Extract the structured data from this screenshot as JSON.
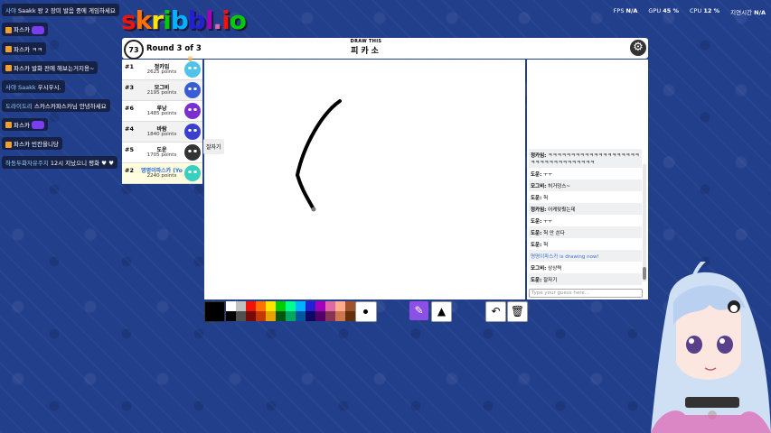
{
  "stream_chat": [
    {
      "nick": "사야",
      "text": "Saakk 왕 2 장미 발음 중에 게임하세요",
      "emote": false
    },
    {
      "nick": "",
      "text": "파스카",
      "emote": true,
      "badge": true
    },
    {
      "nick": "",
      "text": "파스카 ㅋㅋ",
      "emote": false,
      "badge": true
    },
    {
      "nick": "",
      "text": "파스카 발화 전에 해보는거지용~",
      "emote": false,
      "badge": true
    },
    {
      "nick": "사야 Saakk",
      "text": "우시우시.",
      "emote": false
    },
    {
      "nick": "도라이도리",
      "text": "스카스카파스카님 안녕하세요",
      "emote": false
    },
    {
      "nick": "",
      "text": "파스카",
      "emote": true,
      "badge": true
    },
    {
      "nick": "",
      "text": "파스카 빈칸을니당",
      "emote": false,
      "badge": true
    },
    {
      "nick": "하동두화자유주지",
      "text": "12시 지났으니 평화 ♥ ♥",
      "emote": false
    }
  ],
  "perf": {
    "fps_label": "FPS",
    "fps": "N/A",
    "gpu_label": "GPU",
    "gpu": "45 %",
    "cpu_label": "CPU",
    "cpu": "12 %",
    "latency_label": "지연시간",
    "latency": "N/A"
  },
  "logo": {
    "text": "skribbl.io"
  },
  "game": {
    "timer": "73",
    "round": "Round 3 of 3",
    "word_hint": "DRAW THIS",
    "word": "피카소"
  },
  "players": [
    {
      "rank": "#1",
      "name": "정카임",
      "points": "2625 points",
      "color": "#4fc3e8",
      "crown": true
    },
    {
      "rank": "#3",
      "name": "모그비",
      "points": "2195 points",
      "color": "#3a5bd6"
    },
    {
      "rank": "#6",
      "name": "루낭",
      "points": "1485 points",
      "color": "#7c2fd0"
    },
    {
      "rank": "#4",
      "name": "바람",
      "points": "1840 points",
      "color": "#3a3fd0"
    },
    {
      "rank": "#5",
      "name": "도운",
      "points": "1705 points",
      "color": "#333333"
    },
    {
      "rank": "#2",
      "name": "명명이파스카 (Yo",
      "points": "2240 points",
      "color": "#38d0c0",
      "me": true
    }
  ],
  "canvas_label": "잘자기",
  "chat_log": [
    {
      "nick": "정카임:",
      "text": "ㅋㅋㅋㅋㅋㅋㅋㅋㅋㅋㅋㅋㅋㅋㅋㅋㅋㅋㅋㅋㅋㅋㅋㅋㅋㅋㅋㅋㅋㅋㅋㅋㅋㅋ"
    },
    {
      "nick": "도운:",
      "text": "ㅜㅜ"
    },
    {
      "nick": "모그비:",
      "text": "허거덩스~"
    },
    {
      "nick": "도운:",
      "text": "헉"
    },
    {
      "nick": "정카임:",
      "text": "어케맞췄는데"
    },
    {
      "nick": "도운:",
      "text": "ㅜㅜ"
    },
    {
      "nick": "도운:",
      "text": "헉 안 쓴다"
    },
    {
      "nick": "도운:",
      "text": "헉"
    },
    {
      "nick": "",
      "text": "명명이파스카 is drawing now!",
      "system": true
    },
    {
      "nick": "모그비:",
      "text": "상상력"
    },
    {
      "nick": "도운:",
      "text": "잘자기"
    }
  ],
  "chat_input": {
    "placeholder": "Type your guess here..."
  },
  "palette": {
    "current": "#000000",
    "row1": [
      "#ffffff",
      "#c1c1c1",
      "#ef130b",
      "#ff7100",
      "#ffe400",
      "#00cc00",
      "#00ff91",
      "#00b2ff",
      "#231fd3",
      "#a300ba",
      "#df69a7",
      "#ffac8e",
      "#a0522d"
    ],
    "row2": [
      "#000000",
      "#505050",
      "#740b07",
      "#c23800",
      "#e8a200",
      "#005510",
      "#00a85f",
      "#00569e",
      "#0e0865",
      "#550069",
      "#873554",
      "#cc774d",
      "#63300d"
    ]
  },
  "tools": {
    "pen": "pencil-icon",
    "fill": "bucket-icon",
    "undo": "undo-icon",
    "clear": "trash-icon"
  }
}
